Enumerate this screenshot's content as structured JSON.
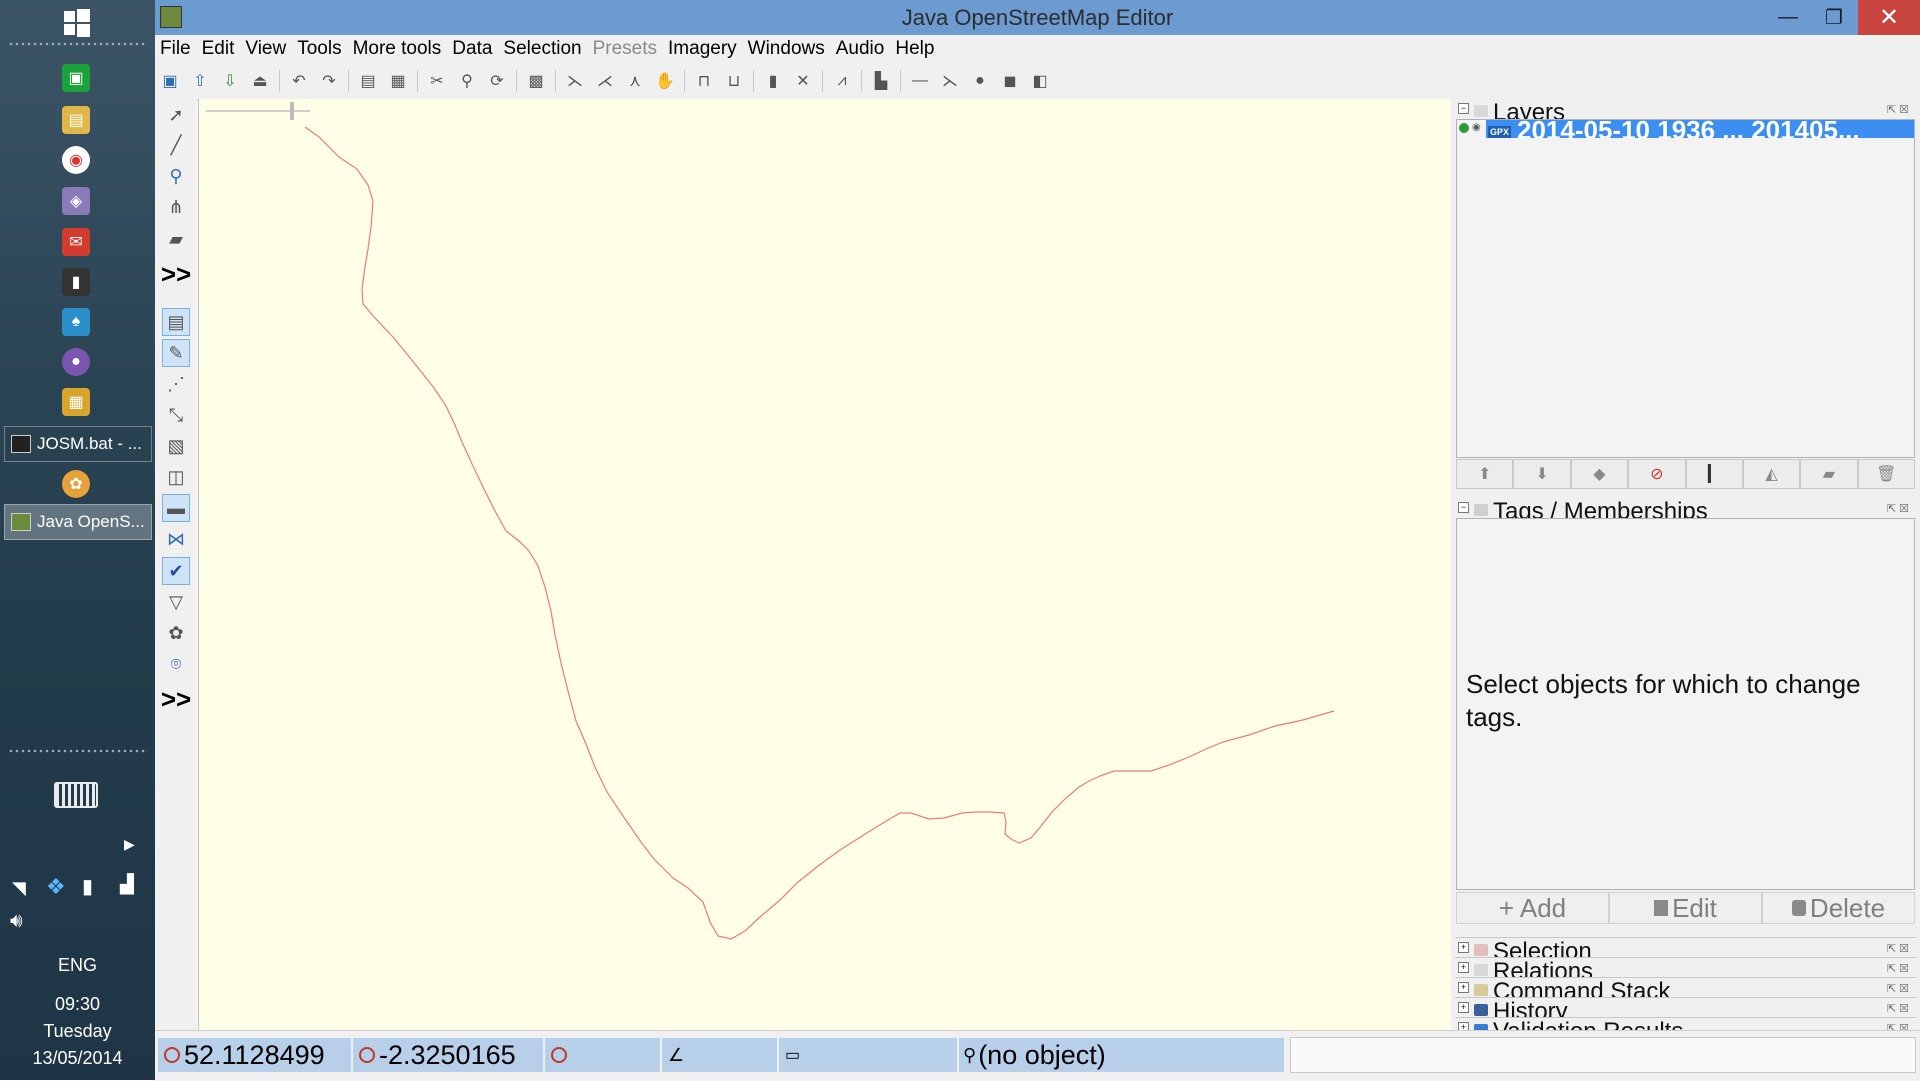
{
  "window": {
    "title": "Java OpenStreetMap Editor",
    "minimize": "—",
    "restore": "❐",
    "close": "✕"
  },
  "menu": [
    "File",
    "Edit",
    "View",
    "Tools",
    "More tools",
    "Data",
    "Selection",
    "Presets",
    "Imagery",
    "Windows",
    "Audio",
    "Help"
  ],
  "menu_disabled": [
    "Presets"
  ],
  "taskbar": {
    "windows": [
      {
        "label": "JOSM.bat - ...",
        "active": false
      },
      {
        "label": "Java OpenS...",
        "active": true
      }
    ],
    "lang": "ENG",
    "time": "09:30",
    "day": "Tuesday",
    "date": "13/05/2014"
  },
  "palette": {
    "more_label": ">>"
  },
  "panels": {
    "layers": {
      "title": "Layers",
      "selected_layer": "2014-05-10 1936 ... 201405..."
    },
    "tags": {
      "title": "Tags / Memberships",
      "message": "Select objects for which to change tags.",
      "add": "+ Add",
      "edit": "Edit",
      "delete": "Delete"
    },
    "collapsed": [
      "Selection",
      "Relations",
      "Command Stack",
      "History",
      "Validation Results"
    ]
  },
  "status": {
    "lat": "52.1128499",
    "lon": "-2.3250165",
    "object": "(no object)"
  },
  "colors": {
    "title_bar": "#6c9bd2",
    "map_bg": "#fffee7",
    "track": "#f07a72",
    "selection": "#3c8ff0"
  }
}
